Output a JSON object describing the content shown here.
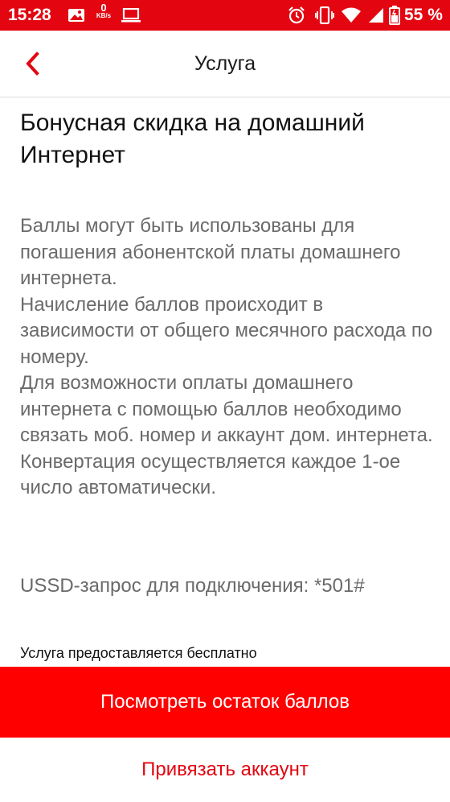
{
  "status_bar": {
    "time": "15:28",
    "speed_value": "0",
    "speed_unit": "KB/s",
    "battery": "55 %",
    "color": "#e30611",
    "icons": [
      "image-icon",
      "network-speed-icon",
      "laptop-icon",
      "alarm-icon",
      "vibrate-icon",
      "wifi-icon",
      "signal-icon",
      "battery-icon"
    ]
  },
  "header": {
    "title": "Услуга",
    "back_icon": "chevron-left-icon"
  },
  "service": {
    "title": "Бонусная скидка на домашний Интернет",
    "description": [
      "Баллы могут быть использованы для погашения абонентской платы домашнего интернета.",
      "Начисление баллов происходит в зависимости от общего месячного расхода по номеру.",
      "Для возможности оплаты домашнего интернета с помощью баллов необходимо связать моб. номер и аккаунт дом. интернета. Конвертация осуществляется каждое 1-ое число автоматически."
    ],
    "ussd": "USSD-запрос для подключения: *501#",
    "price_note": "Услуга предоставляется бесплатно"
  },
  "actions": {
    "primary_label": "Посмотреть остаток баллов",
    "secondary_label": "Привязать аккаунт",
    "accent": "#e30611",
    "button_color": "#ff0000"
  }
}
